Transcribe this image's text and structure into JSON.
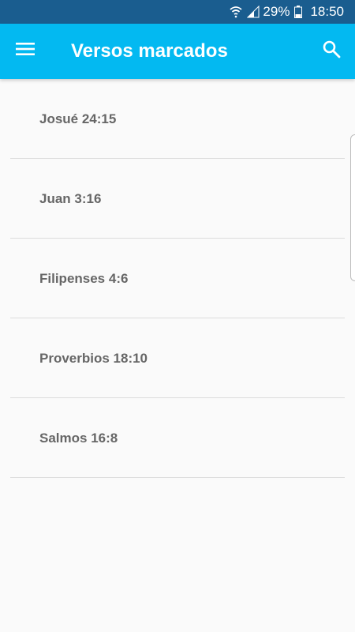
{
  "status_bar": {
    "battery_percent": "29%",
    "time": "18:50",
    "icons": [
      "wifi-icon",
      "signal-icon",
      "battery-icon"
    ]
  },
  "app_bar": {
    "title": "Versos marcados",
    "menu_icon": "hamburger-menu-icon",
    "search_icon": "search-icon",
    "color": "#03b9f1"
  },
  "bookmarks": [
    {
      "label": "Josué 24:15"
    },
    {
      "label": "Juan 3:16"
    },
    {
      "label": "Filipenses 4:6"
    },
    {
      "label": "Proverbios 18:10"
    },
    {
      "label": "Salmos 16:8"
    }
  ]
}
